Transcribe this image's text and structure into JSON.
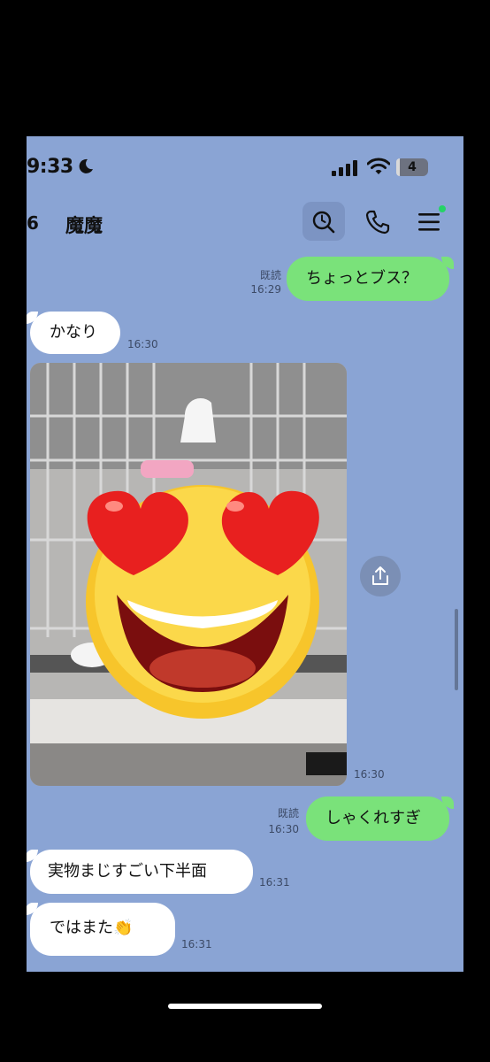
{
  "status_bar": {
    "time": "9:33",
    "moon_icon": "moon-icon",
    "signal_icon": "cellular-signal-icon",
    "wifi_icon": "wifi-icon",
    "battery_level": "4",
    "battery_fraction": 0.04
  },
  "header": {
    "unread_count": "6",
    "chat_title": "魔魔",
    "search_icon": "search-icon",
    "call_icon": "phone-icon",
    "menu_icon": "menu-icon",
    "menu_indicator_color": "#25d366"
  },
  "messages": [
    {
      "side": "out",
      "text": "ちょっとブス？",
      "read": "既読",
      "time": "16:29"
    },
    {
      "side": "in",
      "text": "かなり",
      "time": "16:30"
    },
    {
      "side": "in",
      "type": "image",
      "description_icon": "heart-eyes-emoji",
      "time": "16:30"
    },
    {
      "side": "out",
      "text": "しゃくれすぎ",
      "read": "既読",
      "time": "16:30"
    },
    {
      "side": "in",
      "text": "実物まじすごい下半面",
      "time": "16:31"
    },
    {
      "side": "in",
      "text": "ではまた👏",
      "time": "16:31"
    }
  ],
  "share_icon": "share-icon",
  "colors": {
    "chat_background": "#8aa4d4",
    "outgoing_bubble": "#7ae27a",
    "incoming_bubble": "#ffffff"
  }
}
